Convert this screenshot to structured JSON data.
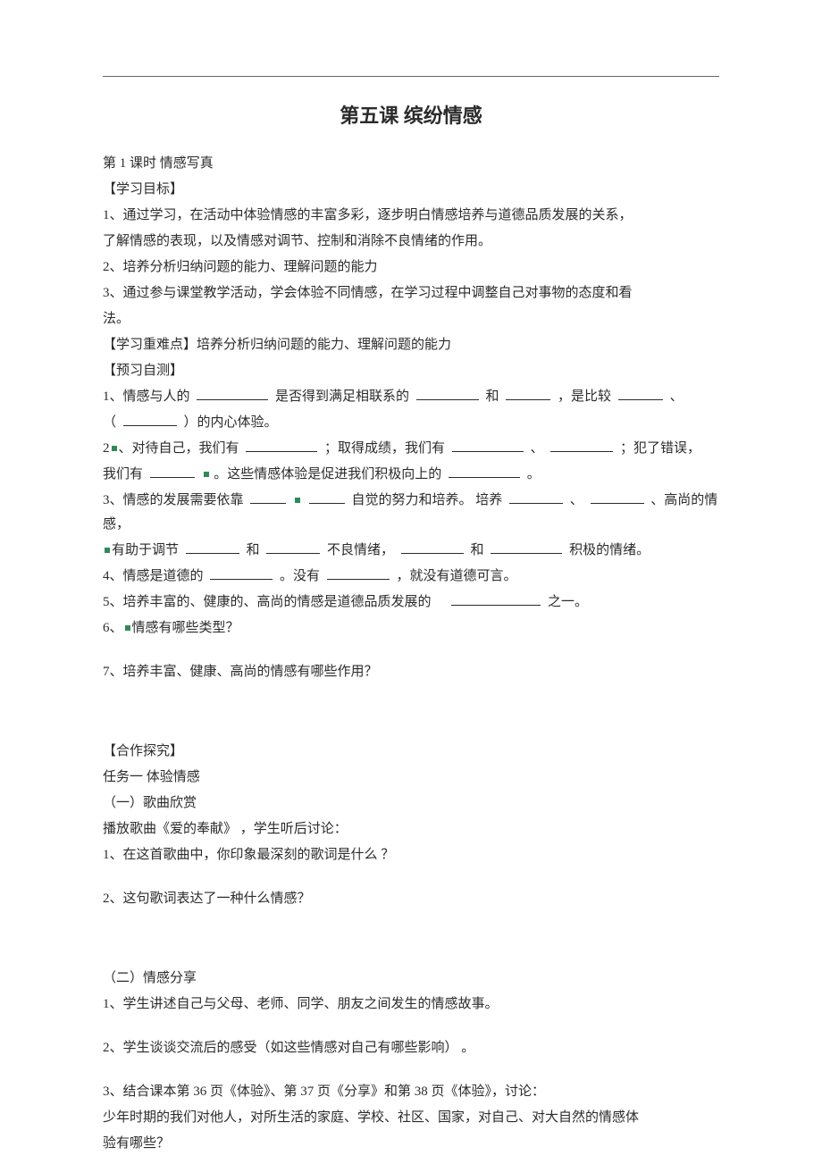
{
  "title": "第五课  缤纷情感",
  "lesson": "第 1 课时    情感写真",
  "sec_goals_header": "【学习目标】",
  "goal1": "1、通过学习，在活动中体验情感的丰富多彩，逐步明白情感培养与道德品质发展的关系，",
  "goal1b": "了解情感的表现，以及情感对调节、控制和消除不良情绪的作用。",
  "goal2": "2、培养分析归纳问题的能力、理解问题的能力",
  "goal3": "3、通过参与课堂教学活动，学会体验不同情感，在学习过程中调整自己对事物的态度和看",
  "goal3b": "法。",
  "sec_diff_header": "【学习重难点】培养分析归纳问题的能力、理解问题的能力",
  "sec_pretest_header": "【预习自测】",
  "q1a": "1、情感与人的",
  "q1b": "是否得到满足相联系的",
  "q1c": "和",
  "q1d": "，是比较",
  "q1e": "、",
  "q1f": "（",
  "q1g": "）的内心体验。",
  "q2a": "2",
  "q2a2": "、对待自己，我们有",
  "q2b": "；取得成绩，我们有",
  "q2c": "、",
  "q2d": "；犯了错误，",
  "q2e": "我们有",
  "q2f": "。这些情感体验是促进我们积极向上的",
  "q2g": "。",
  "q3a": "3、情感的发展需要依靠",
  "q3b": "自觉的努力和培养。  培养",
  "q3c": "、",
  "q3d": "、高尚的情感，",
  "q3e": "有助于调节",
  "q3e_marker": "",
  "q3f": "和",
  "q3g": "不良情绪，",
  "q3h": "和",
  "q3i": "积极的情绪。",
  "q4a": "4、情感是道德的",
  "q4b": "。没有",
  "q4c": "，就没有道德可言。",
  "q5a": "5、培养丰富的、健康的、高尚的情感是道德品质发展的",
  "q5b": "之一。",
  "q6": "6、情感有哪些类型？",
  "q6_marker": "",
  "q7": "7、培养丰富、健康、高尚的情感有哪些作用？",
  "sec_coop_header": "【合作探究】",
  "task1_title": "任务一    体验情感",
  "sub1_header": "（一）歌曲欣赏",
  "sub1_line": "播放歌曲《爱的奉献》  ，学生听后讨论：",
  "sub1_q1": "1、在这首歌曲中，你印象最深刻的歌词是什么      ？",
  "sub1_q2": "2、这句歌词表达了一种什么情感？",
  "sub2_header": "（二）情感分享",
  "sub2_q1": "1、学生讲述自己与父母、老师、同学、朋友之间发生的情感故事。",
  "sub2_q2": "2、学生谈谈交流后的感受（如这些情感对自己有哪些影响）      。",
  "sub2_q3": "3、结合课本第   36 页《体验》、第 37 页《分享》和第   38 页《体验》，讨论：",
  "sub2_q3b": "少年时期的我们对他人，对所生活的家庭、学校、社区、国家，对自己、对大自然的情感体",
  "sub2_q3c": "验有哪些？"
}
